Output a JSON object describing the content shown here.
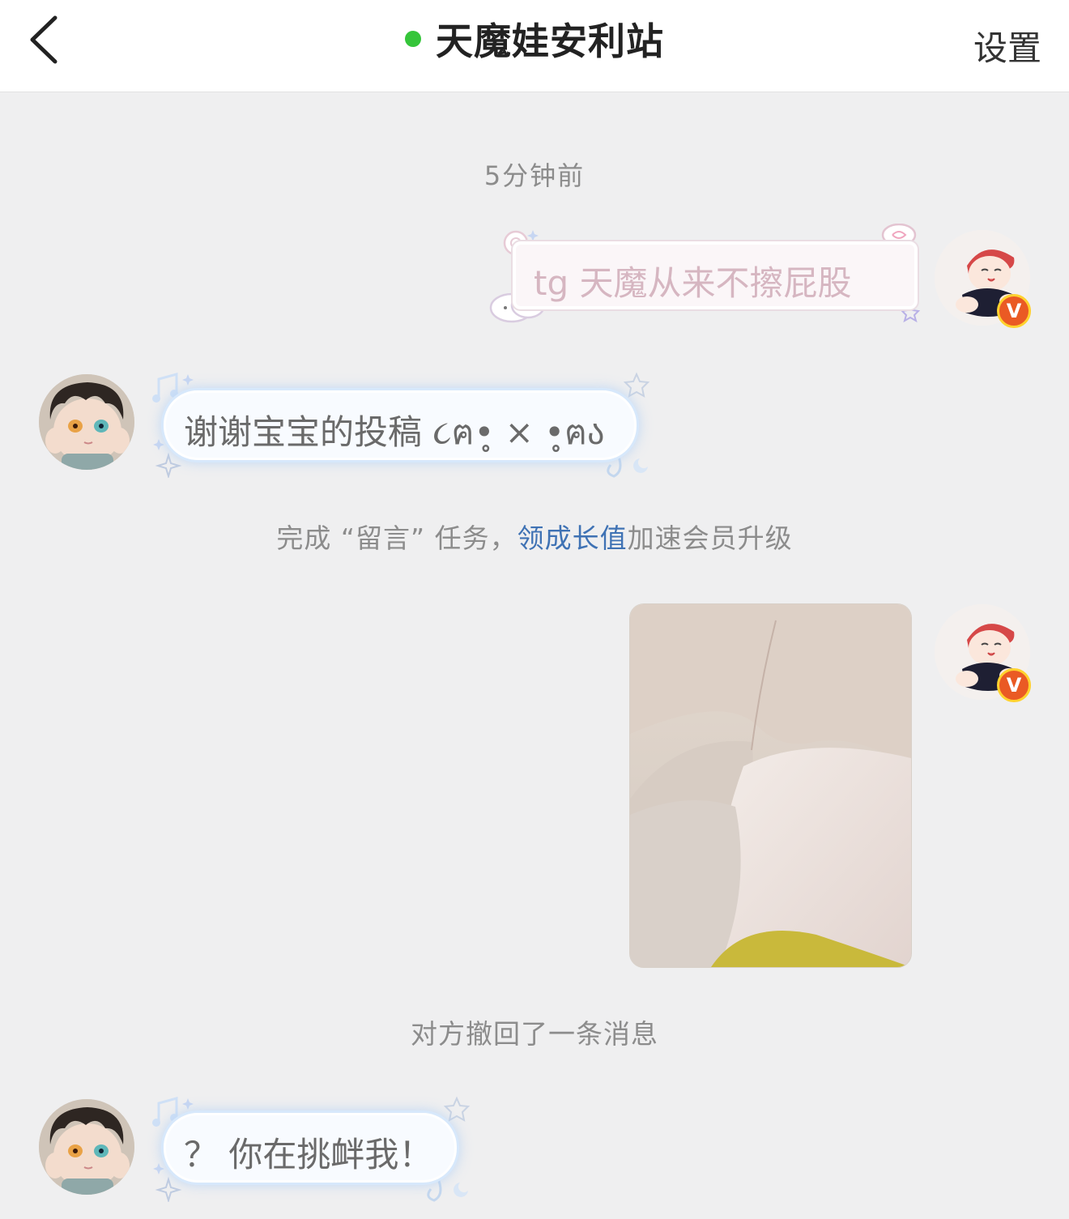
{
  "header": {
    "back_icon": "chevron-left-icon",
    "title": "天魔娃安利站",
    "online_color": "#35c53a",
    "settings_label": "设置"
  },
  "messages": {
    "timestamp": "5分钟前",
    "msg1": {
      "sender": "self",
      "text": "tg 天魔从来不擦屁股"
    },
    "msg2": {
      "sender": "other",
      "text": "谢谢宝宝的投稿 ૮ฅ•̥ × •̥ฅა"
    },
    "system1": {
      "before": "完成 “留言” 任务，",
      "link": "领成长值",
      "after": "加速会员升级"
    },
    "msg3": {
      "sender": "self",
      "type": "image"
    },
    "system2": "对方撤回了一条消息",
    "msg4": {
      "sender": "other",
      "text": "？ 你在挑衅我！"
    }
  },
  "badge": {
    "label": "V",
    "color": "#ea5a24"
  }
}
